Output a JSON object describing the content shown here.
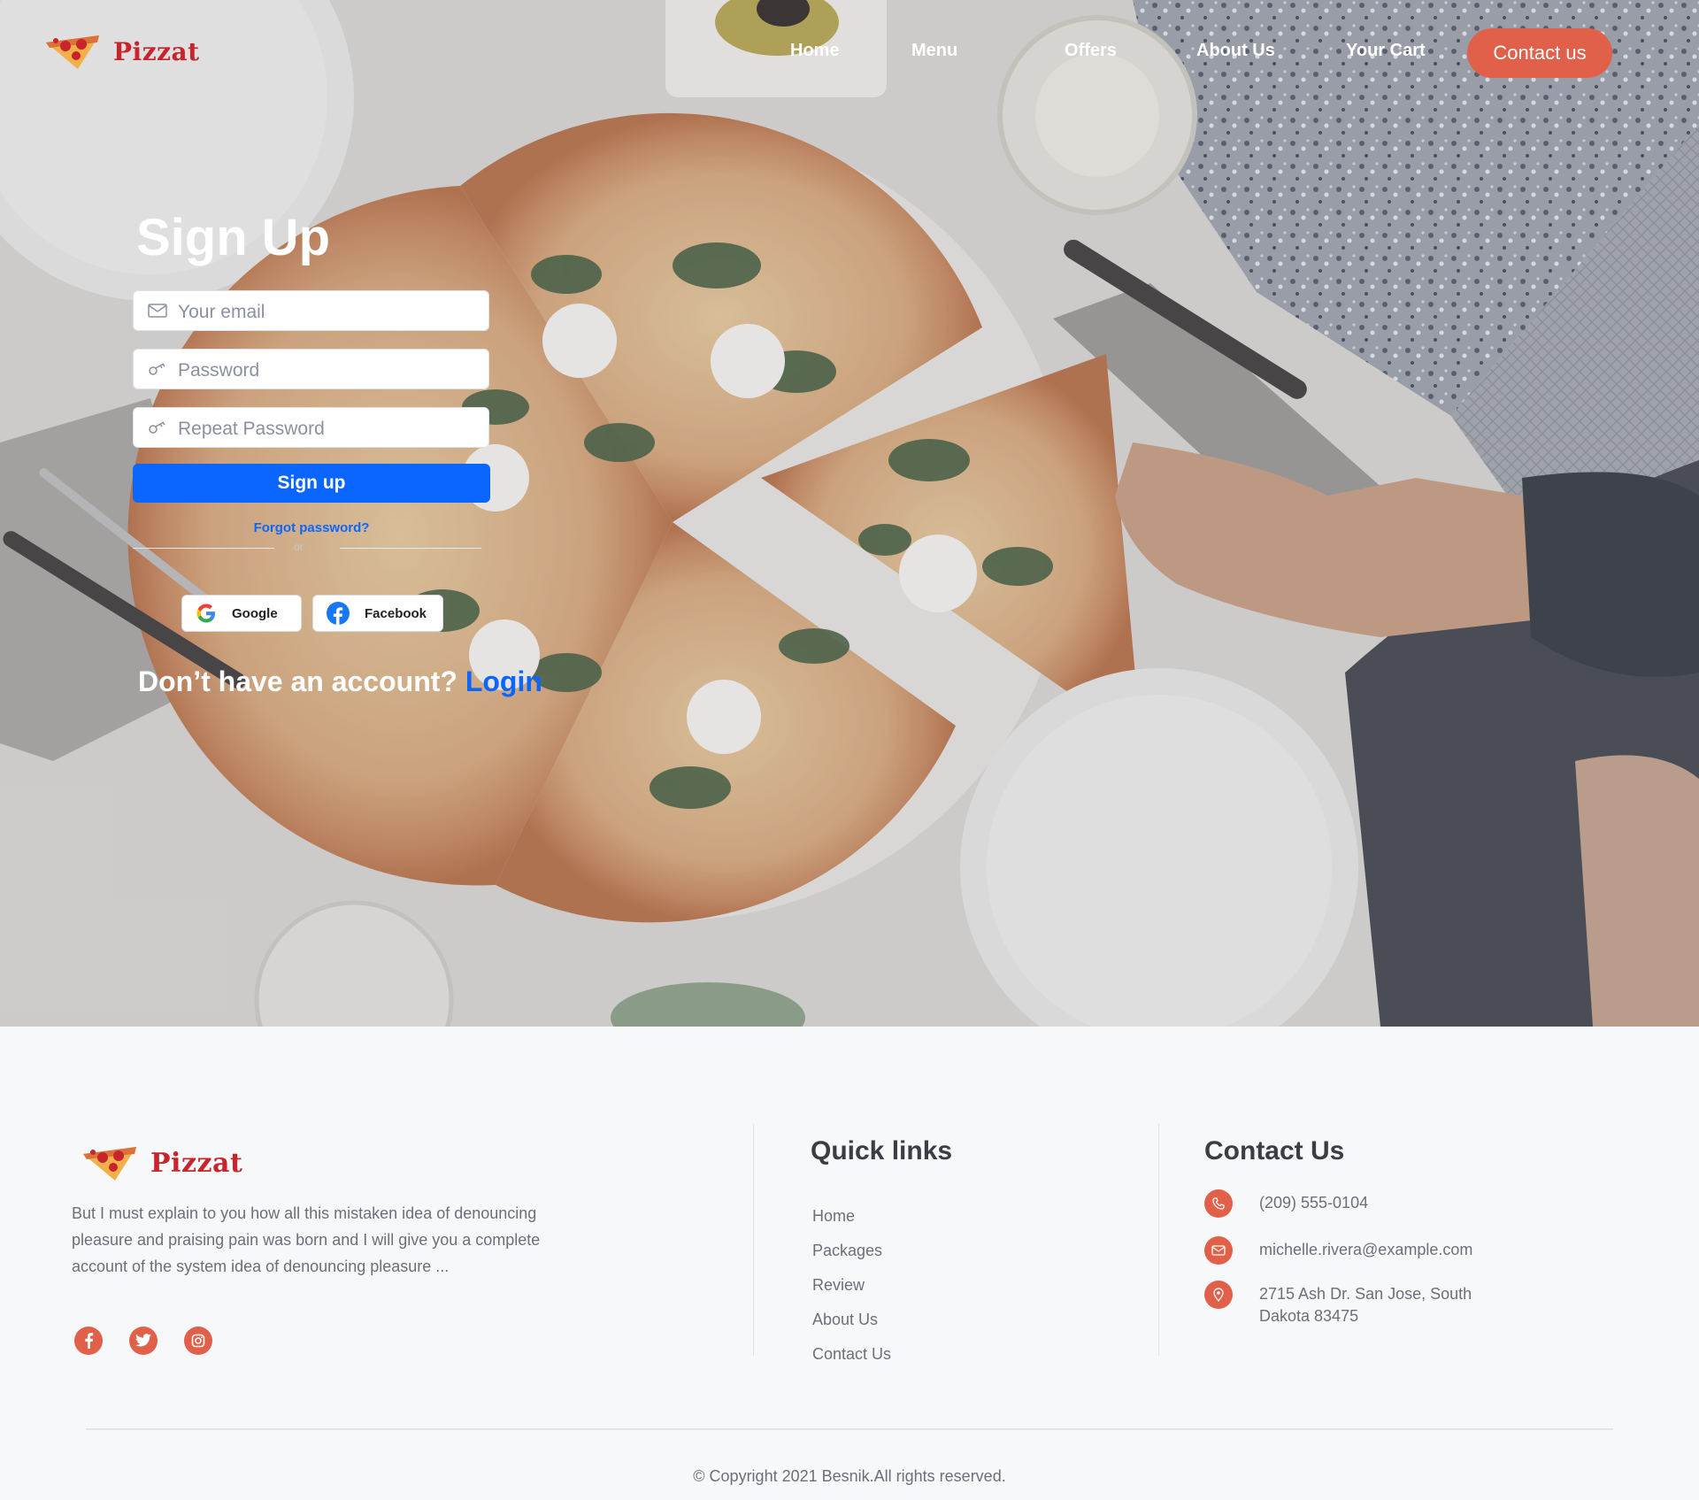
{
  "brand": {
    "name": "Pizzat",
    "color": "#c8242b"
  },
  "nav": {
    "home": "Home",
    "menu": "Menu",
    "offers": "Offers",
    "about": "About Us",
    "cart": "Your Cart",
    "contact_button": "Contact us",
    "contact_color": "#e0604a"
  },
  "signup": {
    "title": "Sign Up",
    "email_placeholder": "Your email",
    "password_placeholder": "Password",
    "repeat_placeholder": "Repeat Password",
    "submit_label": "Sign up",
    "submit_color": "#0a66ff",
    "forgot": "Forgot password?",
    "or": "or",
    "google": "Google",
    "facebook": "Facebook",
    "no_account": "Don’t have an account?",
    "login": "Login"
  },
  "footer": {
    "about": "But I must explain to you how all this mistaken idea of denouncing pleasure and praising pain was born and I will give you a complete account of the system  idea of denouncing pleasure ...",
    "social_icons": [
      "facebook-icon",
      "twitter-icon",
      "instagram-icon"
    ],
    "quick_links_title": "Quick links",
    "quick_links": [
      "Home",
      "Packages",
      "Review",
      "About Us",
      "Contact Us"
    ],
    "contact_title": "Contact Us",
    "phone": "(209) 555-0104",
    "email": "michelle.rivera@example.com",
    "address_line1": "2715 Ash Dr. San Jose, South",
    "address_line2": "Dakota 83475",
    "copyright": "© Copyright 2021 Besnik.All rights reserved."
  }
}
